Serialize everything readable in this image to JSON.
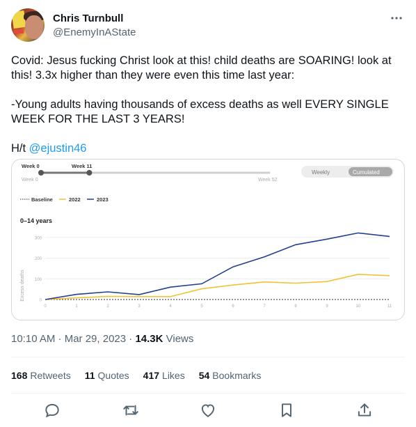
{
  "author": {
    "name": "Chris Turnbull",
    "handle": "@EnemyInAState"
  },
  "tweet": {
    "line1": "Covid: Jesus fucking Christ look at this! child deaths are SOARING! look at this! 3.3x higher than they were even this time last year:",
    "line2": "-Young adults having thousands of excess deaths as well EVERY SINGLE WEEK FOR THE LAST 3 YEARS!",
    "ht_prefix": "H/t ",
    "mention": "@ejustin46"
  },
  "chart_widget": {
    "slider_left_label": "Week 0",
    "slider_current_label": "Week 11",
    "slider_min_label": "Week 0",
    "slider_max_label": "Week 52",
    "slider_value_fraction": 0.2115,
    "toggle_weekly": "Weekly",
    "toggle_cumulated": "Cumulated",
    "legend_baseline": "Baseline",
    "legend_2022": "2022",
    "legend_2023": "2023",
    "age_group": "0–14 years",
    "colors": {
      "2022": "#f2c230",
      "2023": "#253f8f",
      "baseline": "#555555"
    }
  },
  "chart_data": {
    "type": "line",
    "title": "0–14 years",
    "xlabel": "",
    "ylabel": "Excess deaths",
    "x": [
      0,
      1,
      2,
      3,
      4,
      5,
      6,
      7,
      8,
      9,
      10,
      11
    ],
    "xlim": [
      0,
      11
    ],
    "ylim": [
      0,
      330
    ],
    "yticks": [
      0,
      100,
      200,
      300
    ],
    "grid": true,
    "legend": "top-left",
    "series": [
      {
        "name": "Baseline",
        "values": [
          0,
          0,
          0,
          0,
          0,
          0,
          0,
          0,
          0,
          0,
          0,
          0
        ]
      },
      {
        "name": "2022",
        "values": [
          0,
          8,
          15,
          14,
          14,
          52,
          70,
          85,
          79,
          87,
          122,
          115
        ]
      },
      {
        "name": "2023",
        "values": [
          0,
          25,
          37,
          24,
          60,
          76,
          158,
          206,
          265,
          292,
          322,
          305
        ]
      }
    ]
  },
  "meta": {
    "time": "10:10 AM · Mar 29, 2023 · ",
    "views_count": "14.3K",
    "views_label": " Views"
  },
  "stats": {
    "retweets_count": "168",
    "retweets_label": "Retweets",
    "quotes_count": "11",
    "quotes_label": "Quotes",
    "likes_count": "417",
    "likes_label": "Likes",
    "bookmarks_count": "54",
    "bookmarks_label": "Bookmarks"
  },
  "icons": {
    "more": "more-icon",
    "reply": "reply-icon",
    "retweet": "retweet-icon",
    "like": "like-icon",
    "bookmark": "bookmark-icon",
    "share": "share-icon"
  }
}
